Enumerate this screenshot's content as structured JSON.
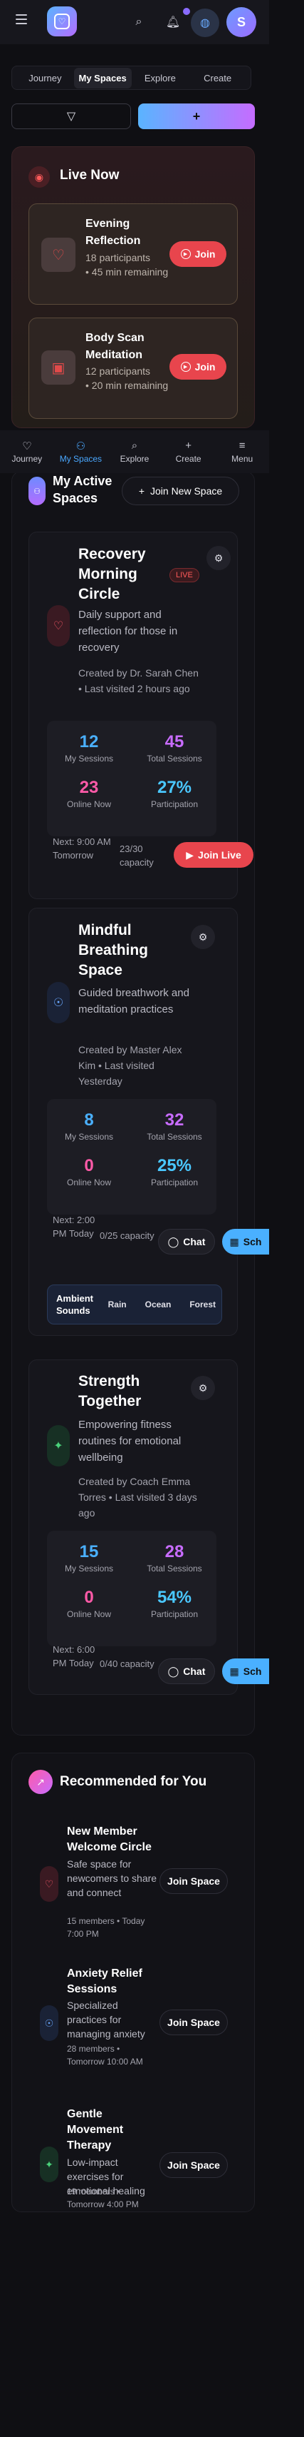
{
  "header": {
    "icons": [
      "menu-icon",
      "logo-icon",
      "search-icon",
      "bell-icon",
      "orbit-icon"
    ],
    "avatar_initial": "S"
  },
  "tabs": [
    {
      "label": "Journey",
      "active": false
    },
    {
      "label": "My Spaces",
      "active": true
    },
    {
      "label": "Explore",
      "active": false
    },
    {
      "label": "Create",
      "active": false
    }
  ],
  "toolbar": {
    "filter_icon": "filter-icon",
    "add_label": "+"
  },
  "live_now": {
    "title": "Live Now",
    "sessions": [
      {
        "name": "Evening Reflection",
        "participants": "18 participants",
        "remaining": "• 45 min remaining",
        "join_label": "Join"
      },
      {
        "name": "Body Scan Meditation",
        "participants": "12 participants",
        "remaining": "• 20 min remaining",
        "join_label": "Join"
      }
    ]
  },
  "bottom_nav": [
    {
      "label": "Journey",
      "icon": "heart-icon",
      "active": false
    },
    {
      "label": "My Spaces",
      "icon": "users-icon",
      "active": true
    },
    {
      "label": "Explore",
      "icon": "search-icon",
      "active": false
    },
    {
      "label": "Create",
      "icon": "plus-icon",
      "active": false
    },
    {
      "label": "Menu",
      "icon": "menu-icon",
      "active": false
    }
  ],
  "my_spaces": {
    "title": "My Active Spaces",
    "new_button": "Join New Space",
    "spaces": [
      {
        "name": "Recovery Morning Circle",
        "badge": "LIVE",
        "description": "Daily support and reflection for those in recovery",
        "creator": "Created by Dr. Sarah Chen • Last visited 2 hours ago",
        "stats": {
          "my_sessions": "12",
          "total_sessions": "45",
          "online_now": "23",
          "participation": "27%"
        },
        "labels": {
          "my_sessions": "My Sessions",
          "total_sessions": "Total Sessions",
          "online_now": "Online Now",
          "participation": "Participation"
        },
        "next": "Next: 9:00 AM Tomorrow",
        "capacity": "23/30 capacity",
        "action": "Join Live"
      },
      {
        "name": "Mindful Breathing Space",
        "description": "Guided breathwork and meditation practices",
        "creator": "Created by Master Alex Kim • Last visited Yesterday",
        "stats": {
          "my_sessions": "8",
          "total_sessions": "32",
          "online_now": "0",
          "participation": "25%"
        },
        "labels": {
          "my_sessions": "My Sessions",
          "total_sessions": "Total Sessions",
          "online_now": "Online Now",
          "participation": "Participation"
        },
        "next": "Next: 2:00 PM Today",
        "capacity": "0/25 capacity",
        "chat": "Chat",
        "schedule": "Sch",
        "sounds": {
          "label": "Ambient Sounds",
          "options": [
            "Rain",
            "Ocean",
            "Forest"
          ]
        }
      },
      {
        "name": "Strength Together",
        "description": "Empowering fitness routines for emotional wellbeing",
        "creator": "Created by Coach Emma Torres • Last visited 3 days ago",
        "stats": {
          "my_sessions": "15",
          "total_sessions": "28",
          "online_now": "0",
          "participation": "54%"
        },
        "labels": {
          "my_sessions": "My Sessions",
          "total_sessions": "Total Sessions",
          "online_now": "Online Now",
          "participation": "Participation"
        },
        "next": "Next: 6:00 PM Today",
        "capacity": "0/40 capacity",
        "chat": "Chat",
        "schedule": "Sch"
      }
    ]
  },
  "recommended": {
    "title": "Recommended for You",
    "items": [
      {
        "name": "New Member Welcome Circle",
        "description": "Safe space for newcomers to share and connect",
        "meta": "15 members • Today 7:00 PM",
        "action": "Join Space"
      },
      {
        "name": "Anxiety Relief Sessions",
        "description": "Specialized practices for managing anxiety",
        "meta": "28 members • Tomorrow 10:00 AM",
        "action": "Join Space"
      },
      {
        "name": "Gentle Movement Therapy",
        "description": "Low-impact exercises for emotional healing",
        "meta": "19 members • Tomorrow 4:00 PM",
        "action": "Join Space"
      }
    ]
  },
  "colors": {
    "accent_blue": "#4ab0ff",
    "accent_purple": "#c86cff",
    "accent_pink": "#ff5aa8",
    "live_red": "#e8454d"
  }
}
